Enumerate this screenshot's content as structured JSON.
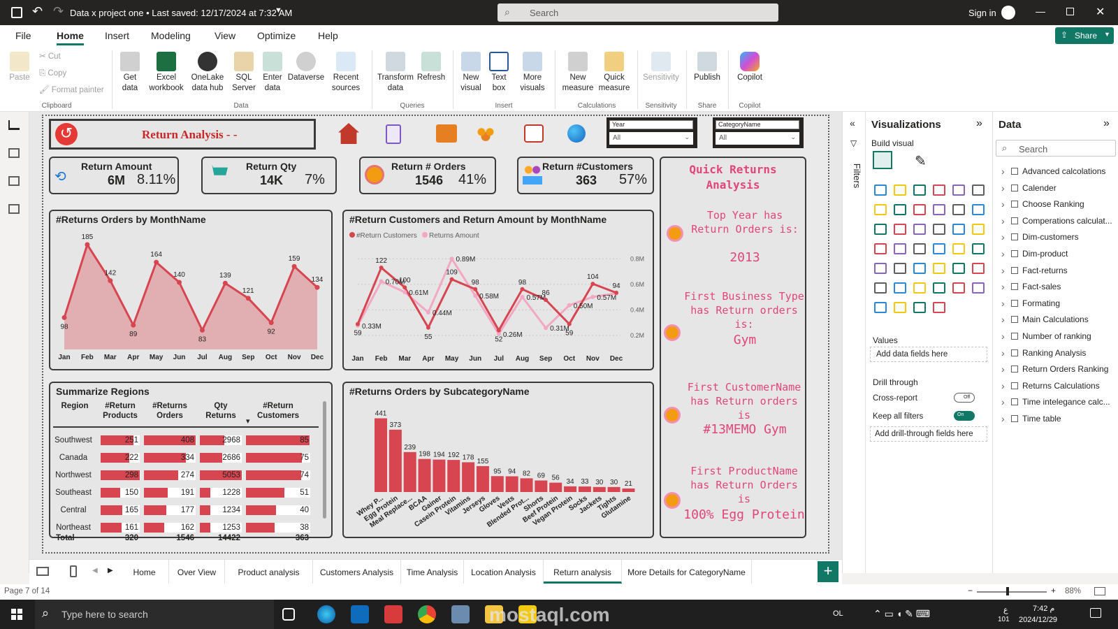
{
  "titlebar": {
    "title": "Data x project one • Last saved: 12/17/2024 at 7:32 AM",
    "search_placeholder": "Search",
    "signin": "Sign in"
  },
  "menu": {
    "items": [
      "File",
      "Home",
      "Insert",
      "Modeling",
      "View",
      "Optimize",
      "Help"
    ],
    "active": "Home",
    "share_label": "Share"
  },
  "ribbon": {
    "clipboard": {
      "paste": "Paste",
      "cut": "Cut",
      "copy": "Copy",
      "format_painter": "Format painter",
      "group": "Clipboard"
    },
    "data": {
      "get_data": "Get data",
      "excel": "Excel workbook",
      "onelake": "OneLake data hub",
      "sql": "SQL Server",
      "enter_data": "Enter data",
      "dataverse": "Dataverse",
      "recent": "Recent sources",
      "group": "Data"
    },
    "queries": {
      "transform": "Transform data",
      "refresh": "Refresh",
      "group": "Queries"
    },
    "insert": {
      "new_visual": "New visual",
      "text_box": "Text box",
      "more_visuals": "More visuals",
      "group": "Insert"
    },
    "calculations": {
      "new_measure": "New measure",
      "quick_measure": "Quick measure",
      "group": "Calculations"
    },
    "sensitivity": {
      "label": "Sensitivity",
      "group": "Sensitivity"
    },
    "share": {
      "publish": "Publish",
      "group": "Share"
    },
    "copilot": {
      "label": "Copilot",
      "group": "Copilot"
    }
  },
  "report": {
    "title": "Return Analysis - -",
    "slicers": {
      "year_label": "Year",
      "year_value": "All",
      "category_label": "CategoryName",
      "category_value": "All"
    },
    "kpis": [
      {
        "label": "Return Amount",
        "value": "6M",
        "pct": "8.11%"
      },
      {
        "label": "Return Qty",
        "value": "14K",
        "pct": "7%"
      },
      {
        "label": "Return # Orders",
        "value": "1546",
        "pct": "41%"
      },
      {
        "label": "Return #Customers",
        "value": "363",
        "pct": "57%"
      }
    ],
    "quick": {
      "title": "Quick Returns Analysis",
      "q1": "Top Year has Return Orders is:",
      "a1": "2013",
      "q2": "First Business Type has Return orders is:",
      "a2": "Gym",
      "q3": "First CustomerName has Return orders is",
      "a3": "#13MEMO Gym",
      "q4": "First ProductName has Return Orders is",
      "a4": "100% Egg Protein"
    },
    "regions": {
      "title": "Summarize Regions",
      "headers": [
        "Region",
        "#Return Products",
        "#Returns Orders",
        "Qty Returns",
        "#Return Customers"
      ],
      "rows": [
        [
          "Southwest",
          "251",
          "408",
          "2968",
          "85"
        ],
        [
          "Canada",
          "222",
          "334",
          "2686",
          "75"
        ],
        [
          "Northwest",
          "298",
          "274",
          "5053",
          "74"
        ],
        [
          "Southeast",
          "150",
          "191",
          "1228",
          "51"
        ],
        [
          "Central",
          "165",
          "177",
          "1234",
          "40"
        ],
        [
          "Northeast",
          "161",
          "162",
          "1253",
          "38"
        ]
      ],
      "total": [
        "Total",
        "320",
        "1546",
        "14422",
        "363"
      ]
    }
  },
  "chart_data": [
    {
      "type": "area",
      "title": "#Returns Orders by MonthName",
      "categories": [
        "Jan",
        "Feb",
        "Mar",
        "Apr",
        "May",
        "Jun",
        "Jul",
        "Aug",
        "Sep",
        "Oct",
        "Nov",
        "Dec"
      ],
      "values": [
        98,
        185,
        142,
        89,
        164,
        140,
        83,
        139,
        121,
        92,
        159,
        134
      ],
      "color": "#d64550"
    },
    {
      "type": "line",
      "title": "#Return Customers and Return Amount by MonthName",
      "categories": [
        "Jan",
        "Feb",
        "Mar",
        "Apr",
        "May",
        "Jun",
        "Jul",
        "Aug",
        "Sep",
        "Oct",
        "Nov",
        "Dec"
      ],
      "series": [
        {
          "name": "#Return Customers",
          "values": [
            59,
            122,
            100,
            55,
            109,
            98,
            52,
            98,
            86,
            59,
            104,
            94
          ],
          "color": "#d64550"
        },
        {
          "name": "Returns Amount",
          "values": [
            0.33,
            0.7,
            0.61,
            0.44,
            0.89,
            0.58,
            0.26,
            0.57,
            0.31,
            0.5,
            0.57,
            0.6
          ],
          "labels": [
            "0.33M",
            "0.70M",
            "0.61M",
            "0.44M",
            "0.89M",
            "0.58M",
            "0.26M",
            "0.57M",
            "0.31M",
            "0.50M",
            "0.57M",
            ""
          ],
          "color": "#f2a7c3"
        }
      ],
      "y2_ticks": [
        "0.2M",
        "0.4M",
        "0.6M",
        "0.8M"
      ]
    },
    {
      "type": "bar",
      "title": "#Returns Orders by SubcategoryName",
      "categories": [
        "Whey P...",
        "Egg Protein",
        "Meal Replace...",
        "BCAA",
        "Gainer",
        "Casein Protein",
        "Vitamins",
        "Jerseys",
        "Gloves",
        "Vests",
        "Blended Prot...",
        "Shorts",
        "Beef Protein",
        "Vegan Protein",
        "Socks",
        "Jackets",
        "Tights",
        "Glutamine"
      ],
      "values": [
        441,
        373,
        239,
        198,
        194,
        192,
        178,
        155,
        95,
        94,
        82,
        69,
        56,
        34,
        33,
        30,
        30,
        21
      ],
      "color": "#d64550"
    }
  ],
  "viz_pane": {
    "title": "Visualizations",
    "build": "Build visual",
    "values": "Values",
    "add_fields": "Add data fields here",
    "drill": "Drill through",
    "cross_report": "Cross-report",
    "cross_state": "Off",
    "keep_filters": "Keep all filters",
    "keep_state": "On",
    "add_drill": "Add drill-through fields here",
    "filters_label": "Filters"
  },
  "data_pane": {
    "title": "Data",
    "search_placeholder": "Search",
    "tables": [
      "Advanced calcolations",
      "Calender",
      "Choose Ranking",
      "Comperations calculat...",
      "Dim-customers",
      "Dim-product",
      "Fact-returns",
      "Fact-sales",
      "Formating",
      "Main Calculations",
      "Number of ranking",
      "Ranking Analysis",
      "Return Orders Ranking",
      "Returns Calculations",
      "Time intelegance calc...",
      "Time table"
    ]
  },
  "pages": {
    "tabs": [
      "Home",
      "Over View",
      "Product analysis",
      "Customers Analysis",
      "Time Analysis",
      "Location Analysis",
      "Return analysis",
      "More Details for CategoryName"
    ],
    "active": "Return analysis"
  },
  "status": {
    "page": "Page 7 of 14",
    "zoom": "88%"
  },
  "taskbar": {
    "search_placeholder": "Type here to search",
    "time": "7:42 م",
    "date": "2024/12/29",
    "lang": "ع",
    "lang2": "101",
    "ol": "OL"
  },
  "watermark": "mostaql.com"
}
